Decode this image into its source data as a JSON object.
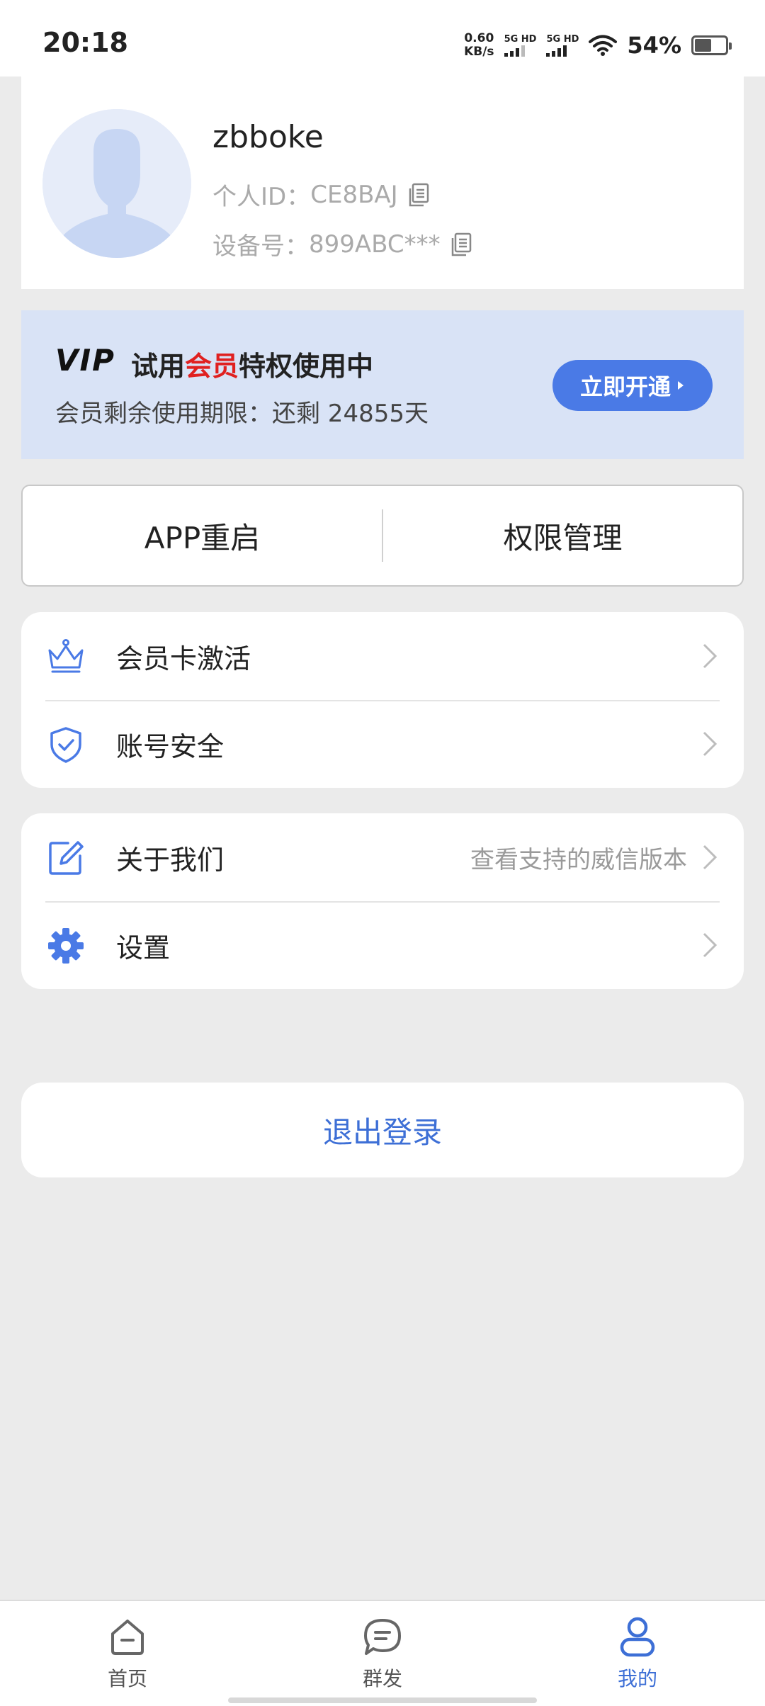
{
  "status_bar": {
    "time": "20:18",
    "net_speed_value": "0.60",
    "net_speed_unit": "KB/s",
    "signal_1_label": "5G HD",
    "signal_2_label": "5G HD",
    "battery_percent": "54%"
  },
  "profile": {
    "username": "zbboke",
    "personal_id_label": "个人ID：",
    "personal_id": "CE8BAJ",
    "device_label": "设备号：",
    "device_id": "899ABC***"
  },
  "vip": {
    "logo_text": "VIP",
    "title_prefix": "试用",
    "title_highlight": "会员",
    "title_suffix": "特权使用中",
    "remain_text": "会员剩余使用期限：还剩 24855天",
    "open_button_label": "立即开通",
    "highlight_color": "#e02020",
    "button_color": "#4a7ae6"
  },
  "quick_actions": {
    "restart_label": "APP重启",
    "permissions_label": "权限管理"
  },
  "menu": {
    "group1": [
      {
        "label": "会员卡激活",
        "icon": "crown-icon"
      },
      {
        "label": "账号安全",
        "icon": "shield-check-icon"
      }
    ],
    "group2": [
      {
        "label": "关于我们",
        "icon": "edit-icon",
        "extra": "查看支持的威信版本"
      },
      {
        "label": "设置",
        "icon": "gear-icon"
      }
    ]
  },
  "logout": {
    "label": "退出登录"
  },
  "bottom_nav": {
    "items": [
      {
        "label": "首页",
        "icon": "home-icon",
        "active": false
      },
      {
        "label": "群发",
        "icon": "chat-bubble-icon",
        "active": false
      },
      {
        "label": "我的",
        "icon": "profile-icon",
        "active": true
      }
    ],
    "active_color": "#3d6fd6"
  }
}
